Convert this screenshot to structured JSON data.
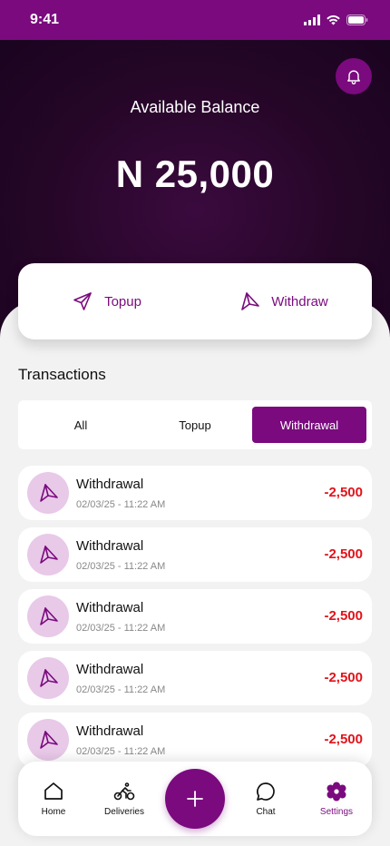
{
  "status_bar": {
    "time": "9:41"
  },
  "balance": {
    "label": "Available Balance",
    "amount": "N 25,000"
  },
  "actions": {
    "topup": "Topup",
    "withdraw": "Withdraw"
  },
  "transactions": {
    "title": "Transactions",
    "tabs": [
      "All",
      "Topup",
      "Withdrawal"
    ],
    "active_tab": "Withdrawal",
    "items": [
      {
        "title": "Withdrawal",
        "date": "02/03/25 - 11:22 AM",
        "amount": "-2,500"
      },
      {
        "title": "Withdrawal",
        "date": "02/03/25 - 11:22 AM",
        "amount": "-2,500"
      },
      {
        "title": "Withdrawal",
        "date": "02/03/25 - 11:22 AM",
        "amount": "-2,500"
      },
      {
        "title": "Withdrawal",
        "date": "02/03/25 - 11:22 AM",
        "amount": "-2,500"
      },
      {
        "title": "Withdrawal",
        "date": "02/03/25 - 11:22 AM",
        "amount": "-2,500"
      }
    ]
  },
  "nav": {
    "home": "Home",
    "deliveries": "Deliveries",
    "chat": "Chat",
    "settings": "Settings",
    "active": "Settings"
  },
  "icons": {
    "bell": "bell-icon",
    "topup": "send-icon",
    "withdraw": "withdraw-icon",
    "home": "home-icon",
    "deliveries": "bicycle-icon",
    "chat": "chat-icon",
    "settings": "gear-icon",
    "add": "plus-icon"
  },
  "colors": {
    "brand": "#7a0a7e",
    "hero_dark": "#250627",
    "amount_negative": "#e2121a",
    "icon_bg": "#e8c9e8"
  }
}
